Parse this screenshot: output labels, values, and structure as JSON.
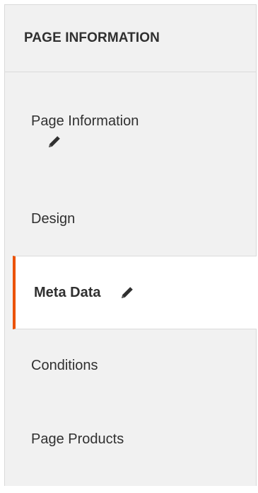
{
  "panel": {
    "title": "PAGE INFORMATION"
  },
  "nav": {
    "items": [
      {
        "label": "Page Information",
        "icon": "pencil-icon",
        "active": false,
        "edited": true
      },
      {
        "label": "Design",
        "active": false,
        "edited": false
      },
      {
        "label": "Meta Data",
        "icon": "pencil-icon",
        "active": true,
        "edited": true
      },
      {
        "label": "Conditions",
        "active": false,
        "edited": false
      },
      {
        "label": "Page Products",
        "active": false,
        "edited": false
      }
    ]
  },
  "colors": {
    "panel_bg": "#f1f1f1",
    "active_bg": "#ffffff",
    "active_accent": "#eb5202",
    "text": "#303030",
    "border": "#dadada"
  }
}
